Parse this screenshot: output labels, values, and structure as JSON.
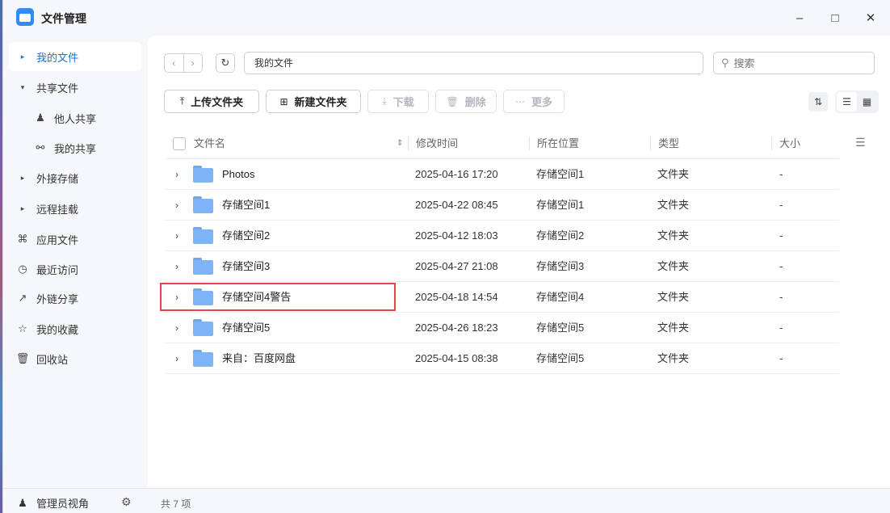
{
  "window": {
    "title": "文件管理",
    "minimize_icon": "minimize-icon",
    "maximize_icon": "maximize-icon",
    "close_icon": "close-icon"
  },
  "sidebar": {
    "items": [
      {
        "label": "我的文件",
        "icon": "caret-right-icon",
        "active": true
      },
      {
        "label": "共享文件",
        "icon": "caret-down-icon"
      },
      {
        "label": "他人共享",
        "icon": "user-icon"
      },
      {
        "label": "我的共享",
        "icon": "share-icon"
      },
      {
        "label": "外接存储",
        "icon": "caret-right-icon"
      },
      {
        "label": "远程挂载",
        "icon": "caret-right-icon"
      },
      {
        "label": "应用文件",
        "icon": "apps-icon"
      },
      {
        "label": "最近访问",
        "icon": "clock-icon"
      },
      {
        "label": "外链分享",
        "icon": "external-link-icon"
      },
      {
        "label": "我的收藏",
        "icon": "star-icon"
      },
      {
        "label": "回收站",
        "icon": "trash-icon"
      }
    ],
    "admin_label": "管理员视角"
  },
  "toolbar": {
    "path": "我的文件",
    "search_placeholder": "搜索",
    "upload_label": "上传文件夹",
    "new_folder_label": "新建文件夹",
    "download_label": "下载",
    "delete_label": "删除",
    "more_label": "更多"
  },
  "table": {
    "headers": {
      "name": "文件名",
      "modified": "修改时间",
      "location": "所在位置",
      "type": "类型",
      "size": "大小"
    },
    "rows": [
      {
        "name": "Photos",
        "modified": "2025-04-16 17:20",
        "location": "存储空间1",
        "type": "文件夹",
        "size": "-"
      },
      {
        "name": "存储空间1",
        "modified": "2025-04-22 08:45",
        "location": "存储空间1",
        "type": "文件夹",
        "size": "-"
      },
      {
        "name": "存储空间2",
        "modified": "2025-04-12 18:03",
        "location": "存储空间2",
        "type": "文件夹",
        "size": "-"
      },
      {
        "name": "存储空间3",
        "modified": "2025-04-27 21:08",
        "location": "存储空间3",
        "type": "文件夹",
        "size": "-"
      },
      {
        "name": "存储空间4警告",
        "modified": "2025-04-18 14:54",
        "location": "存储空间4",
        "type": "文件夹",
        "size": "-"
      },
      {
        "name": "存储空间5",
        "modified": "2025-04-26 18:23",
        "location": "存储空间5",
        "type": "文件夹",
        "size": "-"
      },
      {
        "name": "来自：百度网盘",
        "modified": "2025-04-15 08:38",
        "location": "存储空间5",
        "type": "文件夹",
        "size": "-"
      }
    ]
  },
  "status": {
    "count": "共 7 项"
  },
  "colors": {
    "accent": "#1a73d9",
    "folder": "#7db4f5",
    "highlight_border": "#e64545"
  }
}
